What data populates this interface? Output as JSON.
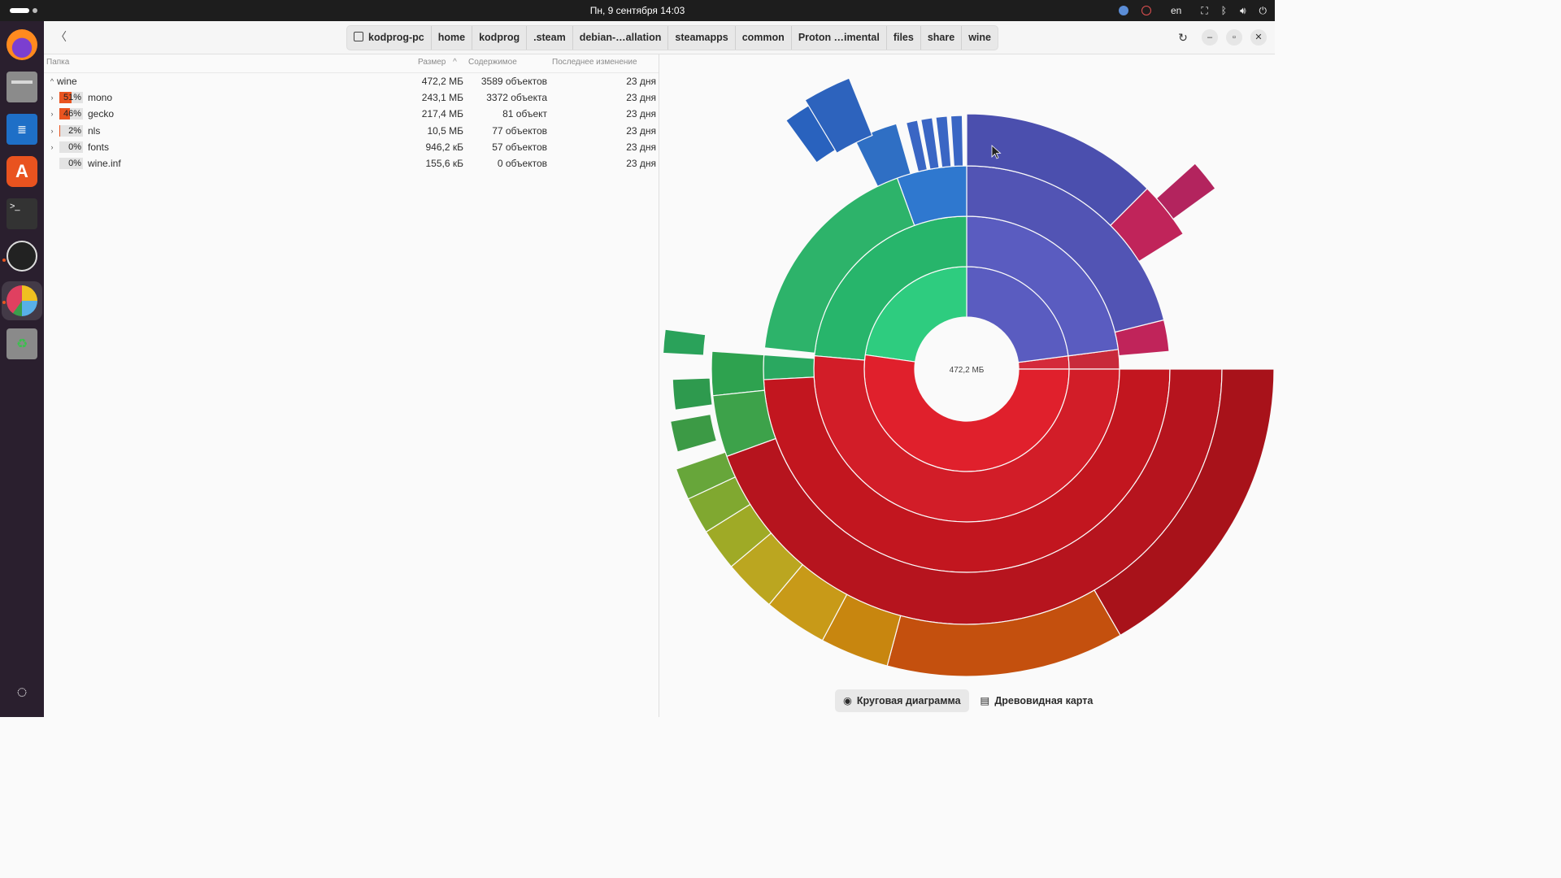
{
  "topbar": {
    "clock": "Пн, 9 сентября  14:03",
    "lang": "en"
  },
  "dock": {
    "apps": [
      "firefox-icon",
      "files-icon",
      "writer-icon",
      "app-center-icon",
      "terminal-icon",
      "obs-icon",
      "disk-usage-icon",
      "trash-icon"
    ]
  },
  "header": {
    "crumbs": [
      "kodprog-pc",
      "home",
      "kodprog",
      ".steam",
      "debian-…allation",
      "steamapps",
      "common",
      "Proton …imental",
      "files",
      "share",
      "wine"
    ]
  },
  "table": {
    "headers": {
      "folder": "Папка",
      "size": "Размер",
      "contents": "Содержимое",
      "modified": "Последнее изменение"
    },
    "root": {
      "name": "wine",
      "size": "472,2 МБ",
      "contents": "3589 объектов",
      "modified": "23 дня"
    },
    "rows": [
      {
        "pct": "51%",
        "fill": 0.51,
        "name": "mono",
        "size": "243,1 МБ",
        "contents": "3372 объекта",
        "modified": "23 дня",
        "expandable": true
      },
      {
        "pct": "46%",
        "fill": 0.46,
        "name": "gecko",
        "size": "217,4 МБ",
        "contents": "81 объект",
        "modified": "23 дня",
        "expandable": true
      },
      {
        "pct": "2%",
        "fill": 0.02,
        "name": "nls",
        "size": "10,5 МБ",
        "contents": "77 объектов",
        "modified": "23 дня",
        "expandable": true
      },
      {
        "pct": "0%",
        "fill": 0.0,
        "name": "fonts",
        "size": "946,2 кБ",
        "contents": "57 объектов",
        "modified": "23 дня",
        "expandable": true
      },
      {
        "pct": "0%",
        "fill": 0.0,
        "name": "wine.inf",
        "size": "155,6 кБ",
        "contents": "0 объектов",
        "modified": "23 дня",
        "expandable": false
      }
    ]
  },
  "chart": {
    "center_label": "472,2 МБ"
  },
  "view_switch": {
    "ring": "Круговая диаграмма",
    "tree": "Древовидная карта"
  }
}
